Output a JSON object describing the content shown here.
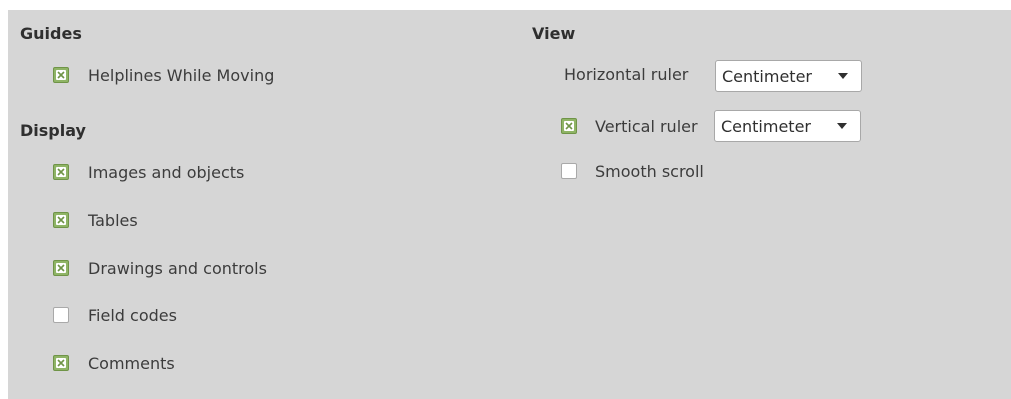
{
  "guides": {
    "heading": "Guides",
    "helplines": {
      "label": "Helplines While Moving",
      "checked": true
    }
  },
  "display": {
    "heading": "Display",
    "items": [
      {
        "label": "Images and objects",
        "checked": true
      },
      {
        "label": "Tables",
        "checked": true
      },
      {
        "label": "Drawings and controls",
        "checked": true
      },
      {
        "label": "Field codes",
        "checked": false
      },
      {
        "label": "Comments",
        "checked": true
      }
    ]
  },
  "view": {
    "heading": "View",
    "horizontal_ruler": {
      "label": "Horizontal ruler",
      "unit": "Centimeter"
    },
    "vertical_ruler": {
      "label": "Vertical ruler",
      "checked": true,
      "unit": "Centimeter"
    },
    "smooth_scroll": {
      "label": "Smooth scroll",
      "checked": false
    }
  },
  "colors": {
    "panel_bg": "#d6d6d6",
    "checkbox_checked": "#8fb466",
    "checkbox_border": "#6f9447",
    "text": "#3c3c3c"
  }
}
